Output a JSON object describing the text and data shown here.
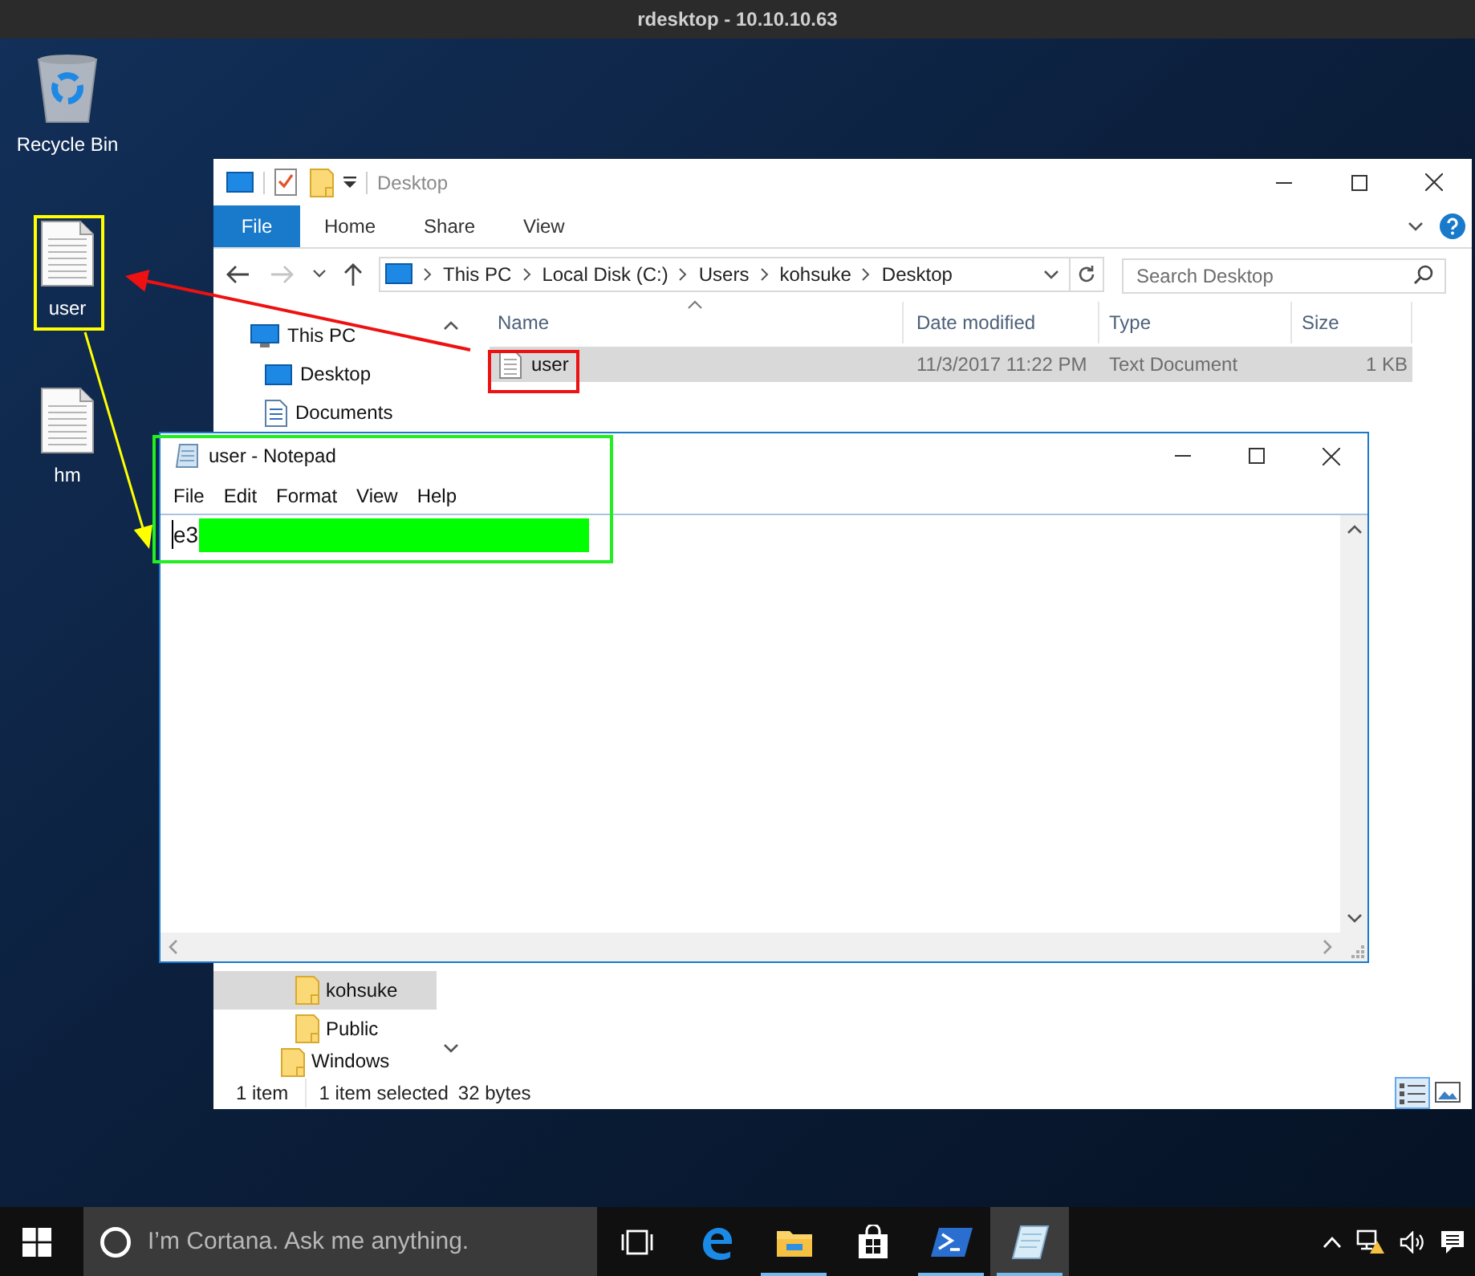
{
  "remote_title": "rdesktop - 10.10.10.63",
  "desktop_icons": [
    {
      "label": "Recycle Bin",
      "kind": "recycle-bin"
    },
    {
      "label": "user",
      "kind": "text-file"
    },
    {
      "label": "hm",
      "kind": "text-file"
    }
  ],
  "explorer": {
    "title": "Desktop",
    "ribbon_tabs": [
      {
        "label": "File",
        "selected": true
      },
      {
        "label": "Home",
        "selected": false
      },
      {
        "label": "Share",
        "selected": false
      },
      {
        "label": "View",
        "selected": false
      }
    ],
    "breadcrumbs": [
      "This PC",
      "Local Disk (C:)",
      "Users",
      "kohsuke",
      "Desktop"
    ],
    "search": {
      "placeholder": "Search Desktop"
    },
    "nav_items": [
      {
        "label": "This PC",
        "kind": "pc",
        "selected": false,
        "children": [
          {
            "label": "Desktop",
            "kind": "desktop",
            "selected": false
          },
          {
            "label": "Documents",
            "kind": "documents",
            "selected": false
          }
        ]
      }
    ],
    "nav_items_lower": [
      {
        "label": "kohsuke",
        "kind": "user-folder",
        "selected": true
      },
      {
        "label": "Public",
        "kind": "user-folder",
        "selected": false
      },
      {
        "label": "Windows",
        "kind": "drive-folder",
        "selected": false
      }
    ],
    "columns": [
      "Name",
      "Date modified",
      "Type",
      "Size"
    ],
    "rows": [
      {
        "name": "user",
        "date_modified": "11/3/2017 11:22 PM",
        "type": "Text Document",
        "size": "1 KB",
        "selected": true
      }
    ],
    "status_bar": {
      "item_count": "1 item",
      "selection": "1 item selected",
      "selection_size": "32 bytes"
    },
    "view_buttons": [
      {
        "kind": "details",
        "selected": true
      },
      {
        "kind": "large-icons",
        "selected": false
      }
    ]
  },
  "notepad": {
    "title": "user - Notepad",
    "menu": [
      "File",
      "Edit",
      "Format",
      "View",
      "Help"
    ],
    "text": "e3",
    "redacted": true
  },
  "taskbar": {
    "search": {
      "placeholder": "I’m Cortana. Ask me anything."
    },
    "apps": [
      {
        "kind": "task-view",
        "running": false,
        "selected": false
      },
      {
        "kind": "edge",
        "running": false,
        "selected": false
      },
      {
        "kind": "file-explorer",
        "running": true,
        "selected": false
      },
      {
        "kind": "store",
        "running": false,
        "selected": false
      },
      {
        "kind": "powershell",
        "running": true,
        "selected": false
      },
      {
        "kind": "notepad",
        "running": true,
        "selected": true
      }
    ],
    "tray": [
      {
        "kind": "chevron"
      },
      {
        "kind": "network-warning"
      },
      {
        "kind": "volume"
      },
      {
        "kind": "notifications"
      }
    ]
  }
}
